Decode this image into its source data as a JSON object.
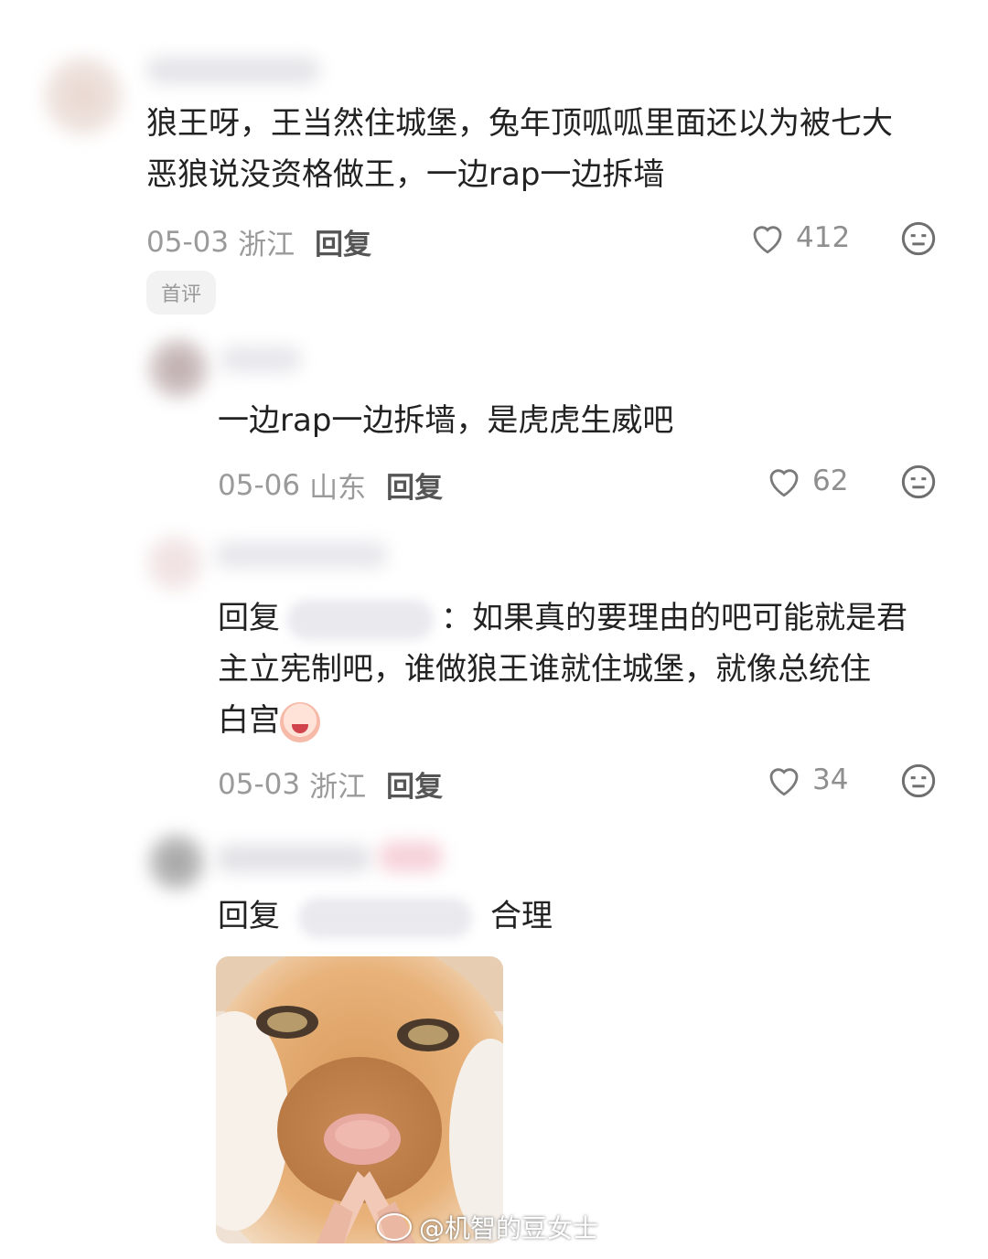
{
  "comments": [
    {
      "text": "狼王呀，王当然住城堡，兔年顶呱呱里面还以为被七大恶狼说没资格做王，一边rap一边拆墙",
      "line1": "狼王呀，王当然住城堡，兔年顶呱呱里面还以为被七大",
      "line2": "恶狼说没资格做王，一边rap一边拆墙",
      "date": "05-03",
      "location": "浙江",
      "reply_label": "回复",
      "likes": "412",
      "badge": "首评"
    },
    {
      "text": "一边rap一边拆墙，是虎虎生威吧",
      "date": "05-06",
      "location": "山东",
      "reply_label": "回复",
      "likes": "62"
    },
    {
      "prefix": "回复",
      "line1_after": "：如果真的要理由的吧可能就是君",
      "line2": "主立宪制吧，谁做狼王谁就住城堡，就像总统住",
      "line3": "白宫",
      "date": "05-03",
      "location": "浙江",
      "reply_label": "回复",
      "likes": "34"
    },
    {
      "prefix": "回复",
      "text": "合理"
    }
  ],
  "watermark": "@机智的豆女士",
  "icons": {
    "like": "heart-outline-icon",
    "dislike": "meh-face-icon"
  },
  "colors": {
    "meta": "#9a9a9a",
    "text": "#222222"
  }
}
